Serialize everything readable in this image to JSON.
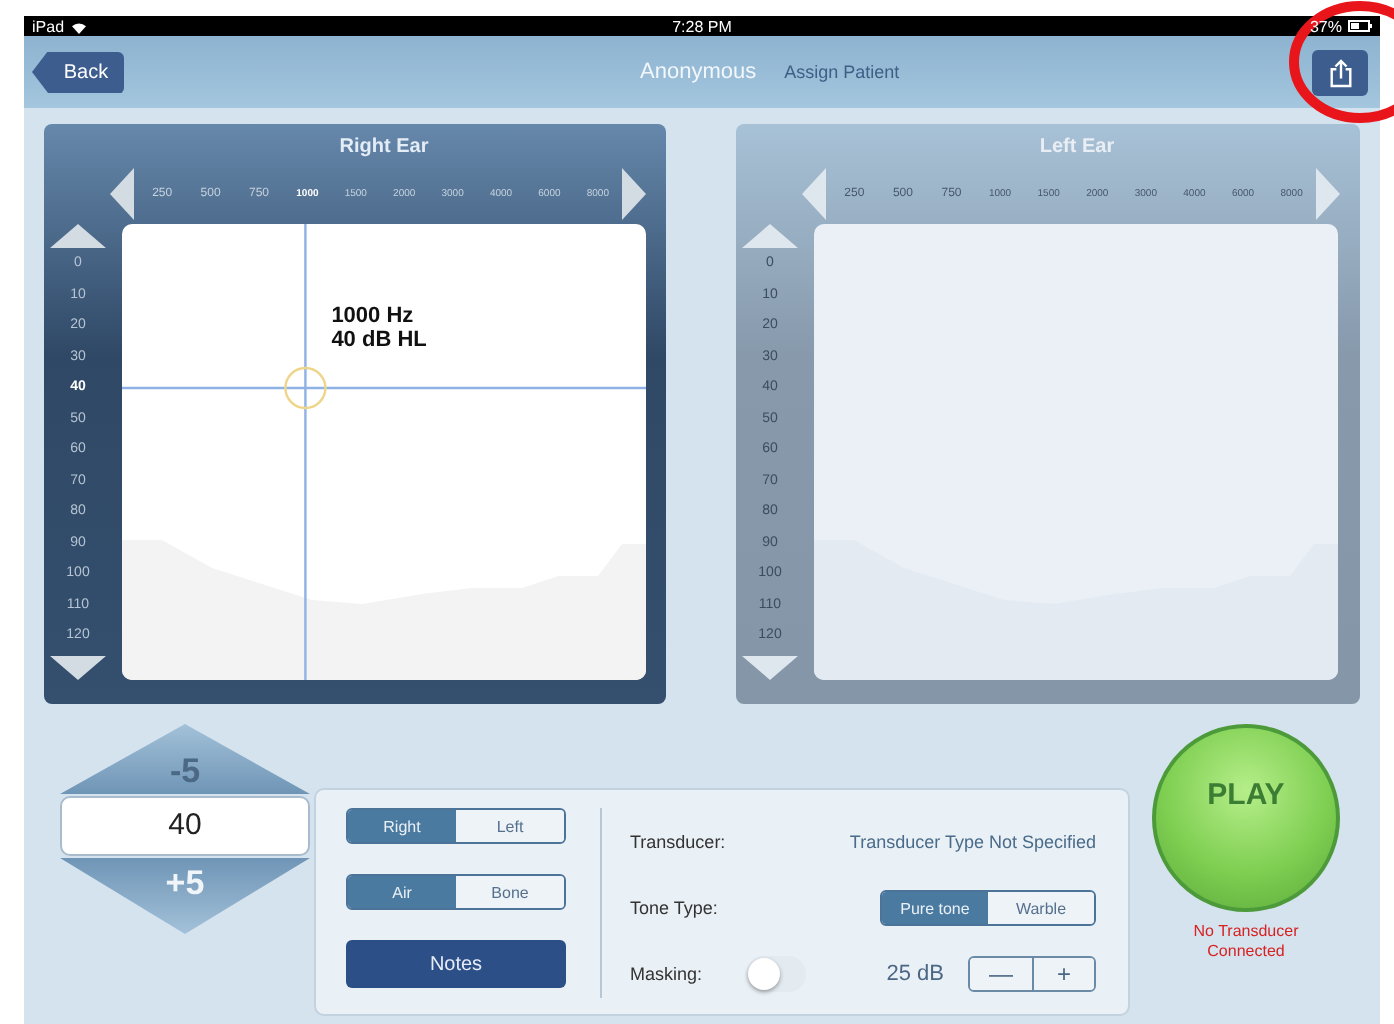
{
  "status_bar": {
    "device": "iPad",
    "time": "7:28 PM",
    "battery": "37%"
  },
  "nav": {
    "back": "Back",
    "patient": "Anonymous",
    "assign": "Assign Patient",
    "share_highlighted": true
  },
  "ears": [
    {
      "title": "Right Ear",
      "selected": true,
      "cursor": {
        "frequency": "1000 Hz",
        "level": "40 dB HL"
      },
      "frequencies": [
        {
          "label": "250",
          "selected": false
        },
        {
          "label": "500",
          "selected": false
        },
        {
          "label": "750",
          "selected": false
        },
        {
          "label": "1000",
          "selected": true
        },
        {
          "label": "1500",
          "selected": false
        },
        {
          "label": "2000",
          "selected": false
        },
        {
          "label": "3000",
          "selected": false
        },
        {
          "label": "4000",
          "selected": false
        },
        {
          "label": "6000",
          "selected": false
        },
        {
          "label": "8000",
          "selected": false
        }
      ],
      "levels": [
        {
          "label": "0",
          "selected": false
        },
        {
          "label": "10",
          "selected": false
        },
        {
          "label": "20",
          "selected": false
        },
        {
          "label": "30",
          "selected": false
        },
        {
          "label": "40",
          "selected": true
        },
        {
          "label": "50",
          "selected": false
        },
        {
          "label": "60",
          "selected": false
        },
        {
          "label": "70",
          "selected": false
        },
        {
          "label": "80",
          "selected": false
        },
        {
          "label": "90",
          "selected": false
        },
        {
          "label": "100",
          "selected": false
        },
        {
          "label": "110",
          "selected": false
        },
        {
          "label": "120",
          "selected": false
        }
      ]
    },
    {
      "title": "Left Ear",
      "selected": false,
      "frequencies": [
        {
          "label": "250",
          "selected": false
        },
        {
          "label": "500",
          "selected": false
        },
        {
          "label": "750",
          "selected": false
        },
        {
          "label": "1000",
          "selected": false
        },
        {
          "label": "1500",
          "selected": false
        },
        {
          "label": "2000",
          "selected": false
        },
        {
          "label": "3000",
          "selected": false
        },
        {
          "label": "4000",
          "selected": false
        },
        {
          "label": "6000",
          "selected": false
        },
        {
          "label": "8000",
          "selected": false
        }
      ],
      "levels": [
        {
          "label": "0",
          "selected": false
        },
        {
          "label": "10",
          "selected": false
        },
        {
          "label": "20",
          "selected": false
        },
        {
          "label": "30",
          "selected": false
        },
        {
          "label": "40",
          "selected": false
        },
        {
          "label": "50",
          "selected": false
        },
        {
          "label": "60",
          "selected": false
        },
        {
          "label": "70",
          "selected": false
        },
        {
          "label": "80",
          "selected": false
        },
        {
          "label": "90",
          "selected": false
        },
        {
          "label": "100",
          "selected": false
        },
        {
          "label": "110",
          "selected": false
        },
        {
          "label": "120",
          "selected": false
        }
      ]
    }
  ],
  "stepper": {
    "decrease": "-5",
    "value": "40",
    "increase": "+5"
  },
  "ear_select": [
    {
      "label": "Right",
      "selected": true
    },
    {
      "label": "Left",
      "selected": false
    }
  ],
  "conduction": [
    {
      "label": "Air",
      "selected": true
    },
    {
      "label": "Bone",
      "selected": false
    }
  ],
  "notes": "Notes",
  "transducer": {
    "label": "Transducer:",
    "value": "Transducer Type Not Specified"
  },
  "tone_type": {
    "label": "Tone Type:",
    "options": [
      {
        "label": "Pure tone",
        "selected": true
      },
      {
        "label": "Warble",
        "selected": false
      }
    ]
  },
  "masking": {
    "label": "Masking:",
    "on": false,
    "value": "25 dB",
    "minus": "—",
    "plus": "+"
  },
  "play": {
    "label": "PLAY",
    "status": "No Transducer Connected"
  }
}
